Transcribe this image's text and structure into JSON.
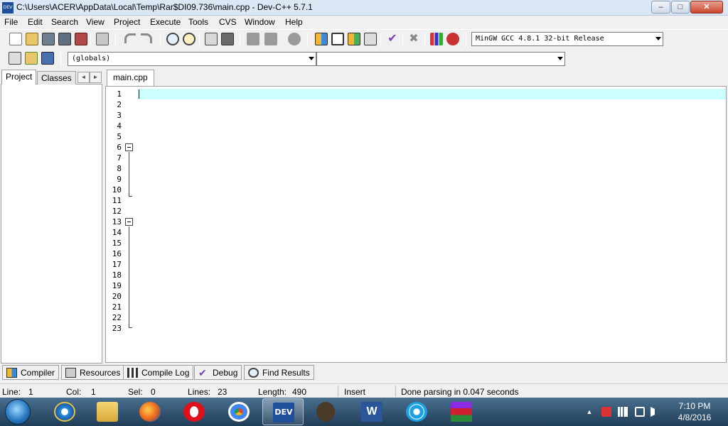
{
  "window": {
    "title": "C:\\Users\\ACER\\AppData\\Local\\Temp\\Rar$DI09.736\\main.cpp - Dev-C++ 5.7.1",
    "app_icon_text": "DEV",
    "minimize": "–",
    "maximize": "□",
    "close": "✕"
  },
  "menu": [
    "File",
    "Edit",
    "Search",
    "View",
    "Project",
    "Execute",
    "Tools",
    "CVS",
    "Window",
    "Help"
  ],
  "toolbar": {
    "compiler_select": "MinGW GCC 4.8.1 32-bit Release",
    "scope_select": "(globals)",
    "member_select": ""
  },
  "left_panel": {
    "tabs": [
      "Project",
      "Classes"
    ],
    "scroll_left": "◄",
    "scroll_right": "►"
  },
  "editor": {
    "tab": "main.cpp",
    "line_numbers": [
      "1",
      "2",
      "3",
      "4",
      "5",
      "6",
      "7",
      "8",
      "9",
      "10",
      "11",
      "12",
      "13",
      "14",
      "15",
      "16",
      "17",
      "18",
      "19",
      "20",
      "21",
      "22",
      "23"
    ]
  },
  "bottom_tabs": [
    "Compiler",
    "Resources",
    "Compile Log",
    "Debug",
    "Find Results"
  ],
  "status": {
    "line_label": "Line:",
    "line_value": "1",
    "col_label": "Col:",
    "col_value": "1",
    "sel_label": "Sel:",
    "sel_value": "0",
    "lines_label": "Lines:",
    "lines_value": "23",
    "length_label": "Length:",
    "length_value": "490",
    "mode": "Insert",
    "message": "Done parsing in 0.047 seconds"
  },
  "taskbar": {
    "time": "7:10 PM",
    "date": "4/8/2016",
    "active_app_label": "DEV",
    "word_label": "W",
    "tray_arrow": "▲"
  },
  "colors": {
    "keyword": "#000000",
    "preprocessor": "#008000",
    "string": "#0000ff",
    "number": "#800080",
    "symbol": "#ff0000",
    "current_line": "#ccffff"
  }
}
